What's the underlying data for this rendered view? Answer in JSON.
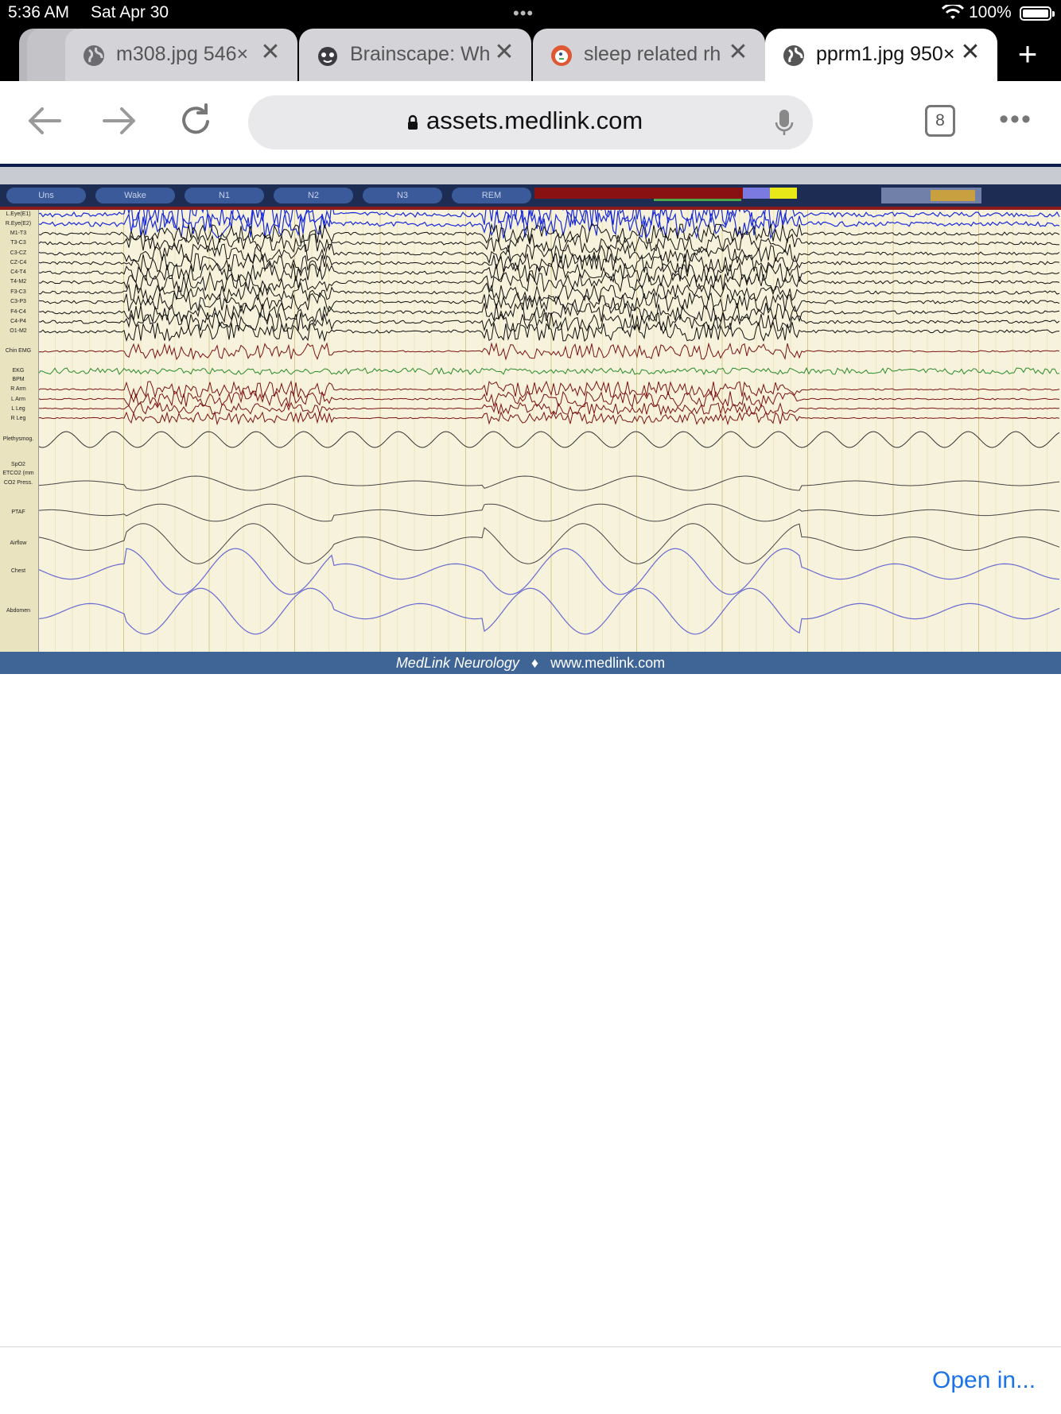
{
  "status_bar": {
    "time": "5:36 AM",
    "date": "Sat Apr 30",
    "dots": "•••",
    "battery": "100%"
  },
  "tabs": [
    {
      "title": "m308.jpg 546×",
      "icon": "globe-icon",
      "active": false
    },
    {
      "title": "Brainscape: Wh",
      "icon": "brainscape-icon",
      "active": false
    },
    {
      "title": "sleep related rh",
      "icon": "duckduckgo-icon",
      "active": false
    },
    {
      "title": "pprm1.jpg 950×",
      "icon": "globe-icon",
      "active": true
    }
  ],
  "toolbar": {
    "url": "assets.medlink.com",
    "tab_count": "8",
    "more": "•••"
  },
  "image": {
    "channels": [
      "L.Eye(E1)",
      "R.Eye(E2)",
      "M1-T3",
      "T3-C3",
      "C3-CZ",
      "CZ-C4",
      "C4-T4",
      "T4-M2",
      "F3-C3",
      "C3-P3",
      "F4-C4",
      "C4-P4",
      "O1-M2",
      "Chin EMG",
      "EKG",
      "BPM",
      "R Arm",
      "L Arm",
      "L Leg",
      "R Leg",
      "Plethysmog.",
      "SpO2",
      "ETCO2 (mm",
      "CO2 Press.",
      "PTAF",
      "Airflow",
      "Chest",
      "Abdomen"
    ],
    "stages": [
      "Uns",
      "Wake",
      "N1",
      "N2",
      "N3",
      "REM"
    ],
    "footer_brand": "MedLink Neurology",
    "footer_sep": "♦",
    "footer_url": "www.medlink.com"
  },
  "footer": {
    "open_in": "Open in..."
  },
  "colors": {
    "status_bg": "#000000",
    "link_blue": "#1a73e8",
    "footer_band": "#3f6496",
    "eeg_blue": "#1a2ad8",
    "emg_red": "#7a1212",
    "ekg_green": "#2a8a2a",
    "resp_violet": "#6a6ad0"
  }
}
